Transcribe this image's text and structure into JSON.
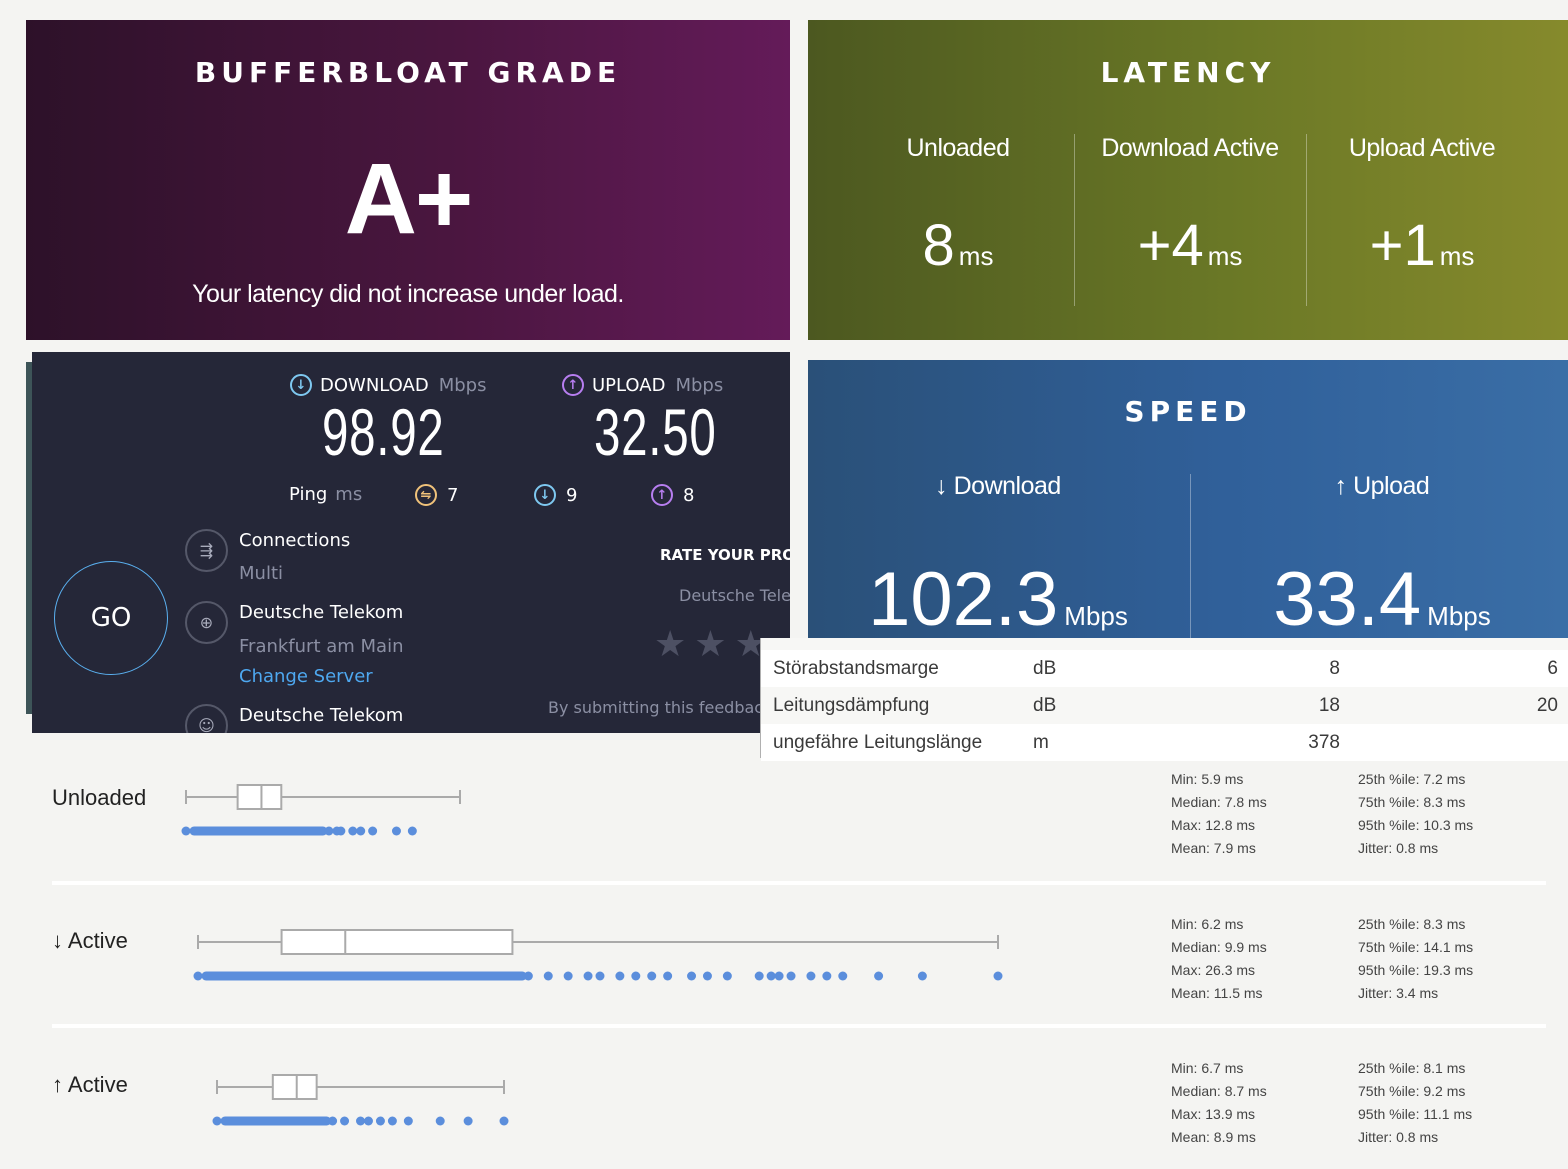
{
  "bufferbloat": {
    "title": "BUFFERBLOAT GRADE",
    "grade": "A+",
    "message": "Your latency did not increase under load."
  },
  "latency": {
    "title": "LATENCY",
    "columns": [
      {
        "label": "Unloaded",
        "value": "8",
        "unit": "ms"
      },
      {
        "label": "Download Active",
        "value": "+4",
        "unit": "ms"
      },
      {
        "label": "Upload Active",
        "value": "+1",
        "unit": "ms"
      }
    ]
  },
  "ookla": {
    "download": {
      "label": "DOWNLOAD",
      "unit": "Mbps",
      "value": "98.92",
      "icon": "download-arrow-icon"
    },
    "upload": {
      "label": "UPLOAD",
      "unit": "Mbps",
      "value": "32.50",
      "icon": "upload-arrow-icon"
    },
    "ping": {
      "label": "Ping",
      "unit": "ms",
      "idle": "7",
      "download": "9",
      "upload": "8"
    },
    "go_label": "GO",
    "connections": {
      "title": "Connections",
      "value": "Multi"
    },
    "server": {
      "title": "Deutsche Telekom",
      "location": "Frankfurt am Main",
      "change_link": "Change Server"
    },
    "provider": {
      "title": "Deutsche Telekom"
    },
    "rate": {
      "title": "RATE YOUR PRO",
      "provider": "Deutsche Tele",
      "stars": 3,
      "submit_text": "By submitting this feedbac"
    },
    "colors": {
      "download": "#7ec8f0",
      "upload": "#b77ef0",
      "ping": "#f0c27a",
      "link": "#4ea8f0"
    }
  },
  "speed": {
    "title": "SPEED",
    "download": {
      "label": "↓ Download",
      "value": "102.3",
      "unit": "Mbps"
    },
    "upload": {
      "label": "↑ Upload",
      "value": "33.4",
      "unit": "Mbps"
    }
  },
  "dsl_table": {
    "rows": [
      {
        "name": "Störabstandsmarge",
        "unit": "dB",
        "value1": "8",
        "value2": "6"
      },
      {
        "name": "Leitungsdämpfung",
        "unit": "dB",
        "value1": "18",
        "value2": "20"
      },
      {
        "name": "ungefähre Leitungslänge",
        "unit": "m",
        "value1": "378",
        "value2": ""
      }
    ]
  },
  "boxplots": [
    {
      "label": "Unloaded",
      "stats_left": [
        "Min: 5.9 ms",
        "Median: 7.8 ms",
        "Max: 12.8 ms",
        "Mean: 7.9 ms"
      ],
      "stats_right": [
        "25th %ile: 7.2 ms",
        "75th %ile: 8.3 ms",
        "95th %ile: 10.3 ms",
        "Jitter: 0.8 ms"
      ],
      "min": 5.9,
      "q1": 7.2,
      "median": 7.8,
      "q3": 8.3,
      "max": 12.8,
      "outliers": [
        9.5,
        9.7,
        9.8,
        10.1,
        10.3,
        10.6,
        11.2,
        11.6
      ]
    },
    {
      "label": "↓ Active",
      "stats_left": [
        "Min: 6.2 ms",
        "Median: 9.9 ms",
        "Max: 26.3 ms",
        "Mean: 11.5 ms"
      ],
      "stats_right": [
        "25th %ile: 8.3 ms",
        "75th %ile: 14.1 ms",
        "95th %ile: 19.3 ms",
        "Jitter: 3.4 ms"
      ],
      "min": 6.2,
      "q1": 8.3,
      "median": 9.9,
      "q3": 14.1,
      "max": 26.3,
      "outliers": [
        14.5,
        15.0,
        15.5,
        16.0,
        16.3,
        16.8,
        17.2,
        17.6,
        18.0,
        18.6,
        19.0,
        19.5,
        20.3,
        20.6,
        20.8,
        21.1,
        21.6,
        22.0,
        22.4,
        23.3,
        24.4,
        26.3
      ]
    },
    {
      "label": "↑ Active",
      "stats_left": [
        "Min: 6.7 ms",
        "Median: 8.7 ms",
        "Max: 13.9 ms",
        "Mean: 8.9 ms"
      ],
      "stats_right": [
        "25th %ile: 8.1 ms",
        "75th %ile: 9.2 ms",
        "95th %ile: 11.1 ms",
        "Jitter: 0.8 ms"
      ],
      "min": 6.7,
      "q1": 8.1,
      "median": 8.7,
      "q3": 9.2,
      "max": 13.9,
      "outliers": [
        9.6,
        9.9,
        10.3,
        10.5,
        10.8,
        11.1,
        11.5,
        12.3,
        13.0,
        13.9
      ]
    }
  ],
  "colors": {
    "bufferbloat_bg": "#4a163f",
    "latency_bg": "#6a7826",
    "speed_bg": "#30609a",
    "ookla_bg": "#252738",
    "dot": "#5b8edc"
  }
}
